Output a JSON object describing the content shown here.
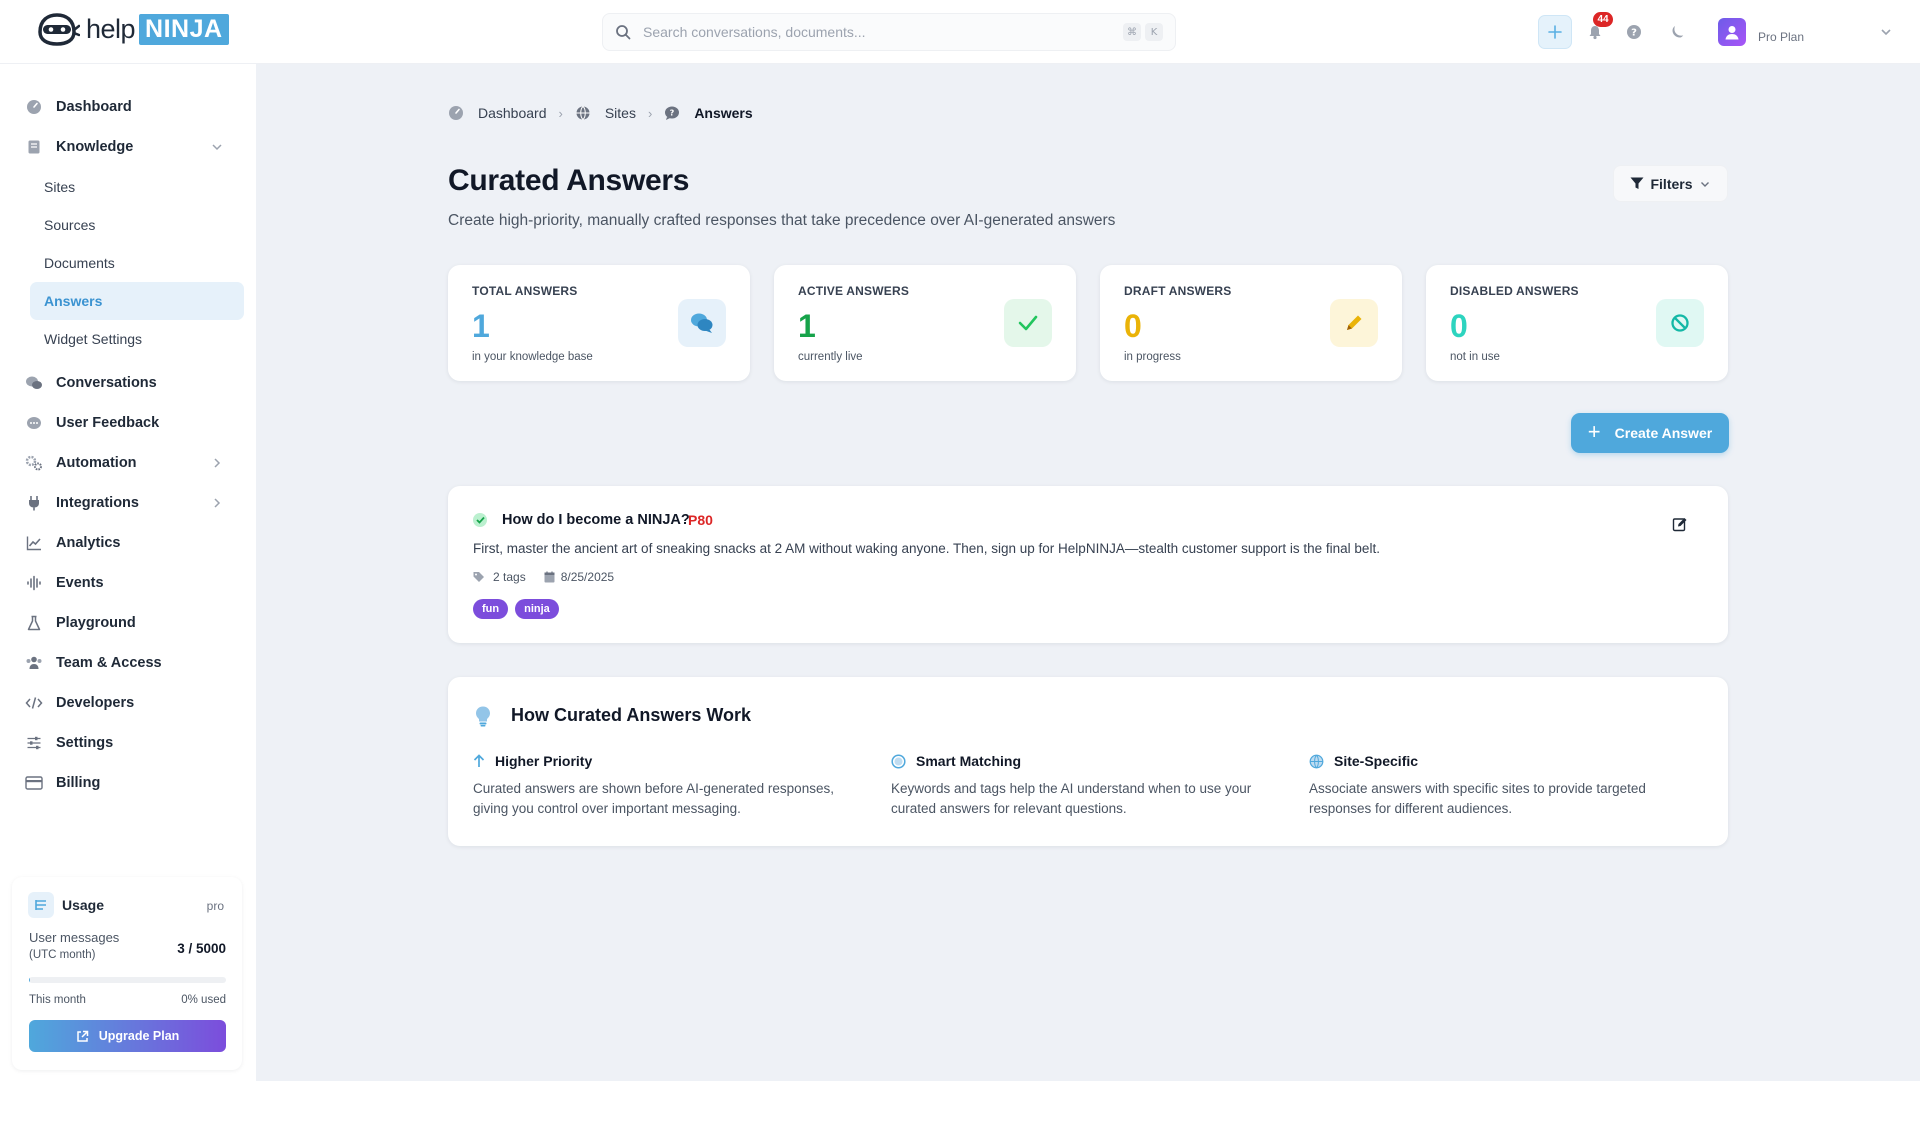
{
  "brand": {
    "help": "help",
    "ninja": "NINJA"
  },
  "header": {
    "search_placeholder": "Search conversations, documents...",
    "shortcut_keys": [
      "⌘",
      "K"
    ],
    "notifications_count": "44",
    "plan_label": "Pro Plan"
  },
  "sidebar": {
    "dashboard": "Dashboard",
    "knowledge": "Knowledge",
    "knowledge_children": [
      "Sites",
      "Sources",
      "Documents",
      "Answers",
      "Widget Settings"
    ],
    "active_child": "Answers",
    "items": [
      "Conversations",
      "User Feedback",
      "Automation",
      "Integrations",
      "Analytics",
      "Events",
      "Playground",
      "Team & Access",
      "Developers",
      "Settings",
      "Billing"
    ]
  },
  "usage": {
    "title": "Usage",
    "plan": "pro",
    "label": "User messages",
    "label_sub": "(UTC month)",
    "value": "3 / 5000",
    "progress_fraction": 0.0006,
    "month_label": "This month",
    "used_label": "0% used",
    "upgrade_label": "Upgrade Plan"
  },
  "breadcrumbs": [
    "Dashboard",
    "Sites",
    "Answers"
  ],
  "page": {
    "title": "Curated Answers",
    "subtitle": "Create high-priority, manually crafted responses that take precedence over AI-generated answers",
    "filters_label": "Filters",
    "create_label": "Create Answer"
  },
  "stats": [
    {
      "label": "TOTAL ANSWERS",
      "value": "1",
      "sub": "in your knowledge base",
      "color": "#4fa8dc",
      "icon": "chat-bubbles-icon"
    },
    {
      "label": "ACTIVE ANSWERS",
      "value": "1",
      "sub": "currently live",
      "color": "#16a34a",
      "icon": "check-icon"
    },
    {
      "label": "DRAFT ANSWERS",
      "value": "0",
      "sub": "in progress",
      "color": "#eab308",
      "icon": "pencil-icon"
    },
    {
      "label": "DISABLED ANSWERS",
      "value": "0",
      "sub": "not in use",
      "color": "#2dd4bf",
      "icon": "ban-icon"
    }
  ],
  "answers": [
    {
      "question": "How do I become a NINJA?",
      "priority": "P80",
      "body": "First, master the ancient art of sneaking snacks at 2 AM without waking anyone. Then, sign up for HelpNINJA—stealth customer support is the final belt.",
      "tags_count": "2 tags",
      "date": "8/25/2025",
      "tags": [
        "fun",
        "ninja"
      ]
    }
  ],
  "how": {
    "title": "How Curated Answers Work",
    "features": [
      {
        "title": "Higher Priority",
        "text": "Curated answers are shown before AI-generated responses, giving you control over important messaging."
      },
      {
        "title": "Smart Matching",
        "text": "Keywords and tags help the AI understand when to use your curated answers for relevant questions."
      },
      {
        "title": "Site-Specific",
        "text": "Associate answers with specific sites to provide targeted responses for different audiences."
      }
    ]
  }
}
